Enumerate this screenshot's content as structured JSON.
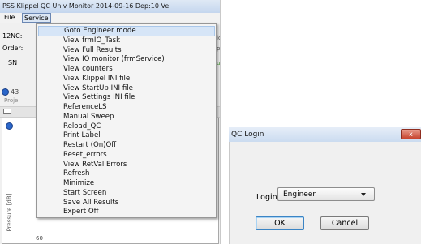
{
  "app": {
    "title": "PSS Klippel QC Univ Monitor  2014-09-16  Dep:10  Ve",
    "menu": {
      "file": "File",
      "service": "Service"
    },
    "labels": {
      "nc": "12NC:",
      "order": "Order:",
      "sn": "SN"
    },
    "hints": [
      "lo",
      "p:",
      "u"
    ],
    "panel_number": "43",
    "project_label": "Proje",
    "y_axis_label": "Pressure [dB]",
    "y_tick": "60",
    "icons": [
      "titlebar-app-icon",
      "blue-circle-icon",
      "toolbar-icon"
    ]
  },
  "service_menu": {
    "items": [
      "Goto Engineer mode",
      "View frmIO_Task",
      "View Full Results",
      "View IO monitor (frmService)",
      "View counters",
      "View Klippel INI file",
      "View StartUp INI file",
      "View Settings INI file",
      "ReferenceLS",
      "Manual Sweep",
      "Reload_QC",
      "Print Label",
      "Restart (On)Off",
      "Reset_errors",
      "View RetVal Errors",
      "Refresh",
      "Minimize",
      "Start Screen",
      "Save All Results",
      "Expert Off"
    ],
    "highlighted_index": 0
  },
  "login_dialog": {
    "title": "QC Login",
    "close_glyph": "x",
    "login_label": "Login",
    "login_value": "Engineer",
    "ok_label": "OK",
    "cancel_label": "Cancel"
  },
  "colors": {
    "menu_highlight": "#d6e5f7",
    "close_button": "#c7432d",
    "accent_blue": "#2a66c9"
  }
}
